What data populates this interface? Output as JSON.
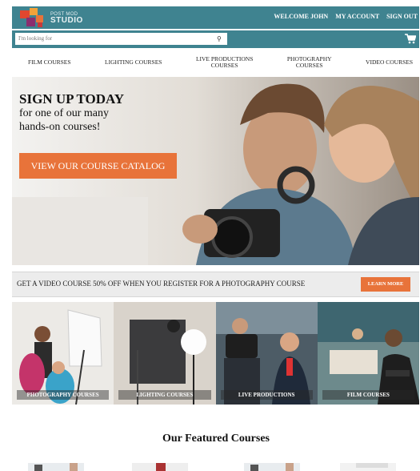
{
  "brand": {
    "line1": "POST MOD",
    "line2": "STUDIO",
    "colors": {
      "teal": "#3f8390",
      "orange": "#e8733a"
    }
  },
  "topnav": {
    "welcome": "WELCOME JOHN",
    "account": "MY ACCOUNT",
    "signout": "SIGN OUT"
  },
  "search": {
    "placeholder": "I'm looking for",
    "icon": "search-icon",
    "cart_icon": "cart-icon"
  },
  "mainnav": {
    "items": [
      {
        "label": "FILM COURSES"
      },
      {
        "label": "LIGHTING COURSES"
      },
      {
        "label_line1": "LIVE PRODUCTIONS",
        "label_line2": "COURSES"
      },
      {
        "label_line1": "PHOTOGRAPHY",
        "label_line2": "COURSES"
      },
      {
        "label": "VIDEO COURSES"
      }
    ]
  },
  "hero": {
    "title": "SIGN UP TODAY",
    "subtitle_line1": "for one of our many",
    "subtitle_line2": "hands-on courses!",
    "cta": "VIEW OUR COURSE CATALOG"
  },
  "promo": {
    "text": "GET A VIDEO COURSE 50% OFF WHEN YOU REGISTER FOR A PHOTOGRAPHY COURSE",
    "button": "LEARN MORE"
  },
  "tiles": [
    {
      "label": "PHOTOGRAPHY COURSES"
    },
    {
      "label": "LIGHTING COURSES"
    },
    {
      "label": "LIVE PRODUCTIONS"
    },
    {
      "label": "FILM COURSES"
    }
  ],
  "featured": {
    "title": "Our Featured Courses"
  }
}
